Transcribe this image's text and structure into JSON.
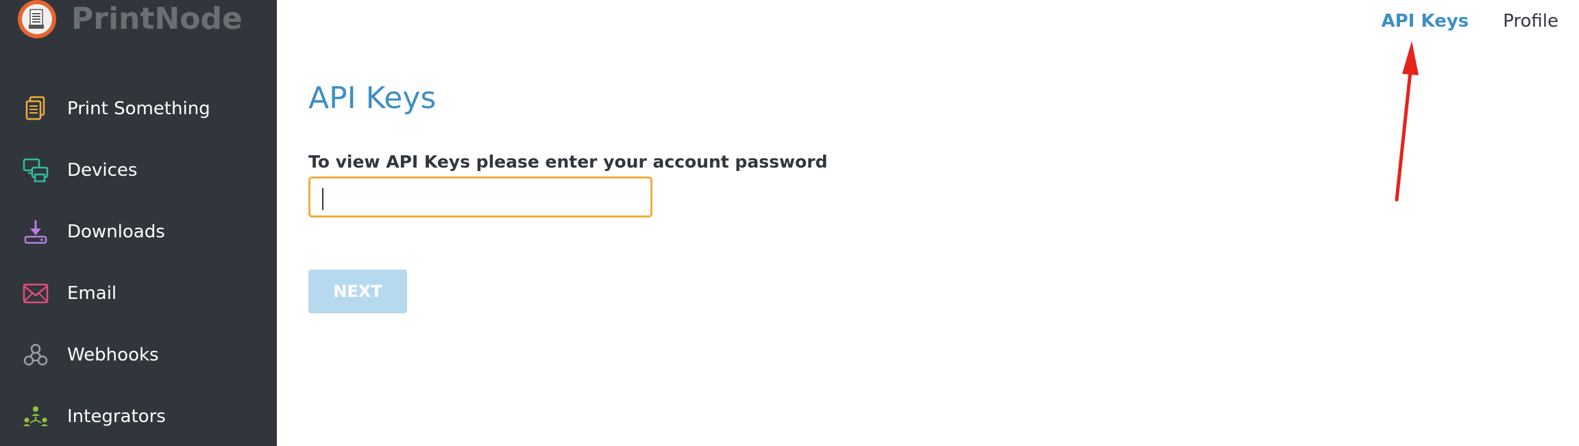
{
  "brand": {
    "name": "PrintNode",
    "logo_icon": "printer-document-icon"
  },
  "sidebar": {
    "items": [
      {
        "label": "Print Something",
        "icon": "document-icon",
        "icon_color": "#f0ad3c"
      },
      {
        "label": "Devices",
        "icon": "devices-icon",
        "icon_color": "#2dbfa0"
      },
      {
        "label": "Downloads",
        "icon": "download-icon",
        "icon_color": "#b77fe0"
      },
      {
        "label": "Email",
        "icon": "envelope-icon",
        "icon_color": "#e0507a"
      },
      {
        "label": "Webhooks",
        "icon": "webhooks-icon",
        "icon_color": "#9aa0a8"
      },
      {
        "label": "Integrators",
        "icon": "integrators-icon",
        "icon_color": "#8fc43a"
      }
    ]
  },
  "topnav": {
    "api_keys": "API Keys",
    "profile": "Profile"
  },
  "main": {
    "title": "API Keys",
    "password_label": "To view API Keys please enter your account password",
    "password_value": "",
    "password_placeholder": "",
    "next_label": "NEXT"
  },
  "colors": {
    "sidebar_bg": "#31353c",
    "accent": "#3d8fc5",
    "input_border": "#f0ad3c",
    "button_disabled": "#b7d9f0",
    "annotation_arrow": "#e5231b"
  }
}
